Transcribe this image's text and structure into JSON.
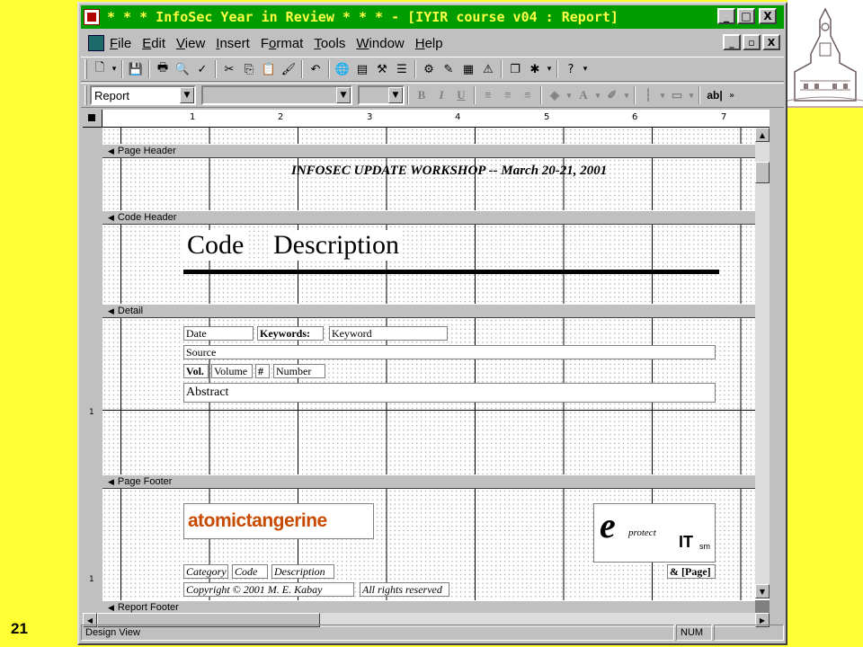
{
  "slide": {
    "number": "21"
  },
  "window": {
    "title": "* * * InfoSec Year in Review * * * - [IYIR course v04 : Report]",
    "title_buttons": {
      "minimize": "_",
      "maximize": "□",
      "close": "X"
    },
    "doc_buttons": {
      "minimize": "_",
      "restore": "▫",
      "close": "X"
    }
  },
  "menu": [
    {
      "u": "F",
      "rest": "ile"
    },
    {
      "u": "E",
      "rest": "dit"
    },
    {
      "u": "V",
      "rest": "iew"
    },
    {
      "u": "I",
      "rest": "nsert"
    },
    {
      "u": "",
      "pre": "F",
      "rest": "o",
      "post": "rmat"
    },
    {
      "u": "T",
      "rest": "ools"
    },
    {
      "u": "W",
      "rest": "indow"
    },
    {
      "u": "H",
      "rest": "elp"
    }
  ],
  "toolbar": {
    "object_combo": "Report",
    "font_combo": "",
    "size_combo": "",
    "controls_label": "ab|"
  },
  "sections": {
    "page_header": "Page Header",
    "code_header": "Code Header",
    "detail": "Detail",
    "page_footer": "Page Footer",
    "report_footer": "Report Footer"
  },
  "report": {
    "header_title": "INFOSEC UPDATE WORKSHOP -- March 20-21, 2001",
    "code_label": "Code",
    "description_label": "Description",
    "detail": {
      "date": "Date",
      "keywords_label": "Keywords:",
      "keyword": "Keyword",
      "source": "Source",
      "vol_label": "Vol.",
      "volume": "Volume",
      "hash_label": "#",
      "number": "Number",
      "abstract": "Abstract"
    },
    "footer": {
      "logo_left": "atomictangerine",
      "logo_right_e": "e",
      "logo_right_protect": "protect",
      "logo_right_it": "IT",
      "logo_right_sm": "sm",
      "category": "Category",
      "code": "Code",
      "description": "Description",
      "page_expr": "& [Page]",
      "copyright": "Copyright © 2001 M. E. Kabay",
      "rights": "All rights reserved"
    }
  },
  "ruler": [
    "1",
    "2",
    "3",
    "4",
    "5",
    "6",
    "7"
  ],
  "status": {
    "mode": "Design View",
    "num": "NUM"
  }
}
